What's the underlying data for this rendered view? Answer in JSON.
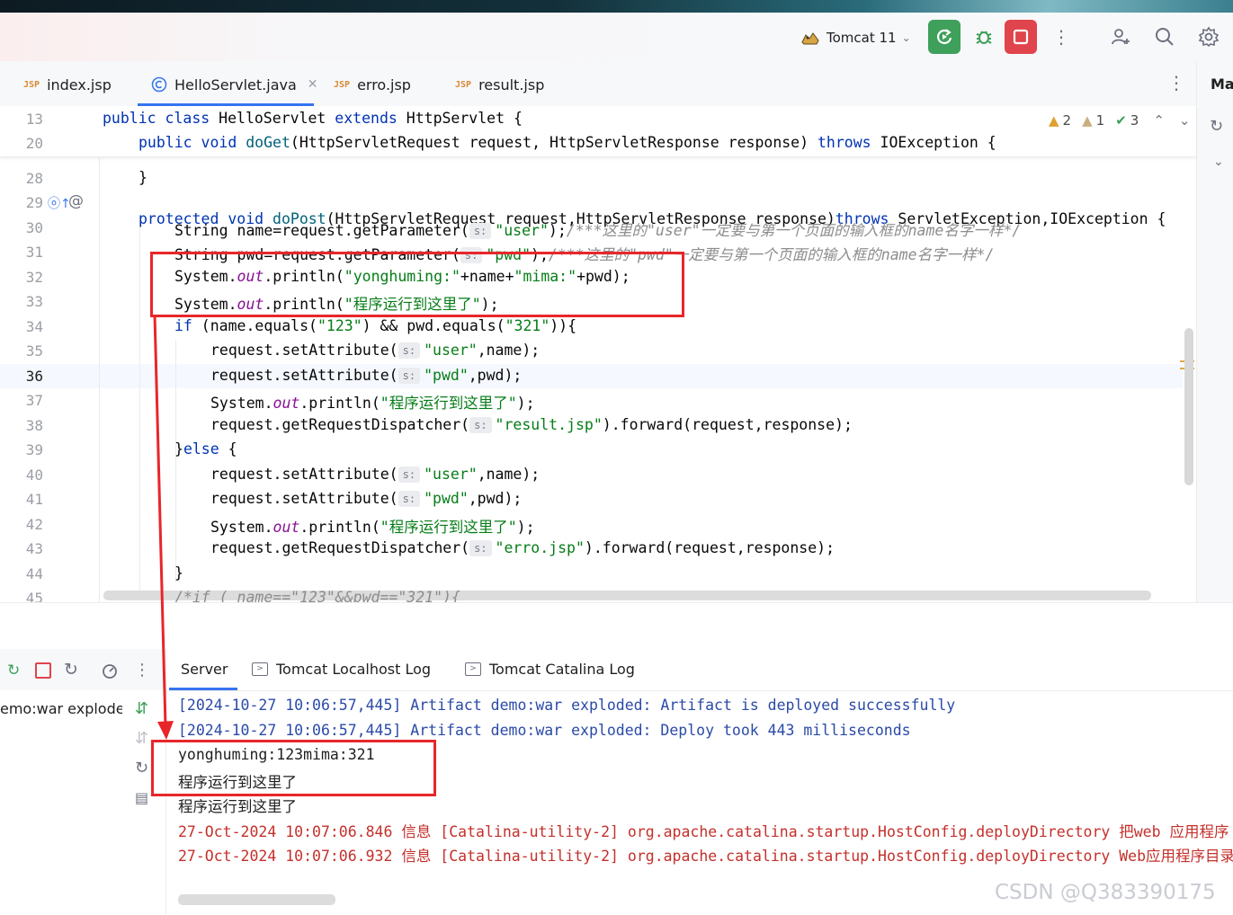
{
  "toolbar": {
    "run_config": "Tomcat 11",
    "colors": {
      "run_green": "#3ea05a",
      "stop_red": "#e0444c"
    }
  },
  "tabs": [
    {
      "label": "index.jsp",
      "icon": "JSP",
      "active": false
    },
    {
      "label": "HelloServlet.java",
      "icon": "class-icon",
      "active": true
    },
    {
      "label": "erro.jsp",
      "icon": "JSP",
      "active": false
    },
    {
      "label": "result.jsp",
      "icon": "JSP",
      "active": false
    }
  ],
  "right_panel_label": "Ma",
  "inspections": {
    "warnings": "2",
    "weak_warnings": "1",
    "ok": "3"
  },
  "sticky": [
    {
      "line": "13",
      "code": "public class HelloServlet extends HttpServlet {"
    },
    {
      "line": "20",
      "code": "public void doGet(HttpServletRequest request, HttpServletResponse response) throws IOException {"
    }
  ],
  "lines": {
    "n28": "28",
    "n29": "29",
    "n30": "30",
    "n31": "31",
    "n32": "32",
    "n33": "33",
    "n34": "34",
    "n35": "35",
    "n36": "36",
    "n37": "37",
    "n38": "38",
    "n39": "39",
    "n40": "40",
    "n41": "41",
    "n42": "42",
    "n43": "43",
    "n44": "44",
    "n45": "45"
  },
  "code": {
    "l28": "}",
    "l29_a": "protected void ",
    "l29_b": "doPost",
    "l29_c": "(HttpServletRequest request,HttpServletResponse response)",
    "l29_d": "throws",
    "l29_e": " ServletException,IOException {",
    "l30_a": "String name=request.getParameter(",
    "l30_b": "\"user\"",
    "l30_c": ");",
    "l30_d": "/***这里的\"user\"一定要与第一个页面的输入框的name名字一样*/",
    "l31_a": "String pwd=request.getParameter(",
    "l31_b": "\"pwd\"",
    "l31_c": ");",
    "l31_d": "/***这里的\"pwd\"一定要与第一个页面的输入框的name名字一样*/",
    "l32_a": "System.",
    "l32_b": "out",
    "l32_c": ".println(",
    "l32_d": "\"yonghuming:\"",
    "l32_e": "+name+",
    "l32_f": "\"mima:\"",
    "l32_g": "+pwd);",
    "l33_d": "\"程序运行到这里了\"",
    "l33_g": ");",
    "l34_a": "if",
    "l34_b": " (name.equals(",
    "l34_c": "\"123\"",
    "l34_d": ") && pwd.equals(",
    "l34_e": "\"321\"",
    "l34_f": ")){",
    "l35_a": "request.setAttribute(",
    "l35_b": "\"user\"",
    "l35_c": ",name);",
    "l36_b": "\"pwd\"",
    "l36_c": ",pwd);",
    "l38_a": "request.getRequestDispatcher(",
    "l38_b": "\"result.jsp\"",
    "l38_c": ").forward(request,response);",
    "l39_a": "}",
    "l39_b": "else",
    "l39_c": " {",
    "l43_b": "\"erro.jsp\"",
    "l44": "}",
    "l45": "/*if ( name==\"123\"&&pwd==\"321\"){",
    "param_hint": "s:"
  },
  "console": {
    "tabs": [
      "Server",
      "Tomcat Localhost Log",
      "Tomcat Catalina Log"
    ],
    "deployment": "emo:war exploded",
    "lines": [
      "[2024-10-27 10:06:57,445] Artifact demo:war exploded: Artifact is deployed successfully",
      "[2024-10-27 10:06:57,445] Artifact demo:war exploded: Deploy took 443 milliseconds",
      "yonghuming:123mima:321",
      "程序运行到这里了",
      "程序运行到这里了",
      "27-Oct-2024 10:07:06.846 信息 [Catalina-utility-2] org.apache.catalina.startup.HostConfig.deployDirectory 把web 应用程序",
      "27-Oct-2024 10:07:06.932 信息 [Catalina-utility-2] org.apache.catalina.startup.HostConfig.deployDirectory Web应用程序目录"
    ]
  },
  "watermark": "CSDN @Q383390175",
  "annotation_color": "#e8262a"
}
